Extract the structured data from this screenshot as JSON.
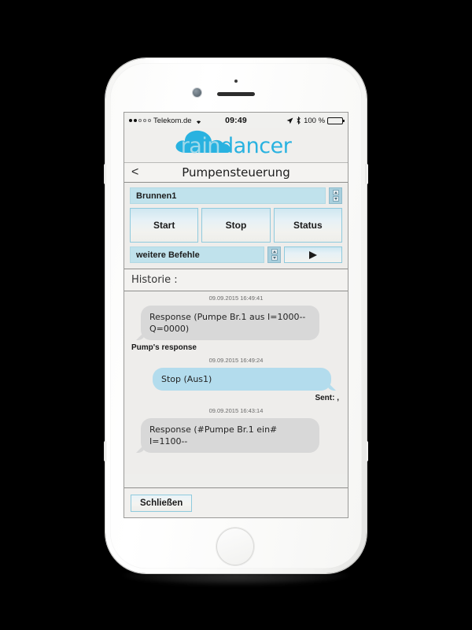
{
  "status_bar": {
    "signal_dots": [
      true,
      true,
      false,
      false,
      false
    ],
    "carrier": "Telekom.de",
    "wifi_icon": "wifi-icon",
    "time": "09:49",
    "location_icon": "location-arrow-icon",
    "bluetooth_icon": "bluetooth-icon",
    "battery_percent": "100 %",
    "battery_level": 100
  },
  "logo": {
    "part1": "rain",
    "part2": "dancer",
    "cloud_icon": "cloud-icon",
    "color_light": "#9fd9ea",
    "color_dark": "#29b2e0"
  },
  "nav": {
    "back_icon": "<",
    "title": "Pumpensteuerung"
  },
  "controls": {
    "well_select": {
      "value": "Brunnen1",
      "stepper_up_icon": "chevron-up-icon",
      "stepper_down_icon": "chevron-down-icon"
    },
    "buttons": [
      {
        "label": "Start",
        "name": "start-button"
      },
      {
        "label": "Stop",
        "name": "stop-button"
      },
      {
        "label": "Status",
        "name": "status-button"
      }
    ],
    "command_select": {
      "value": "weitere Befehle",
      "stepper_up_icon": "chevron-up-icon",
      "stepper_down_icon": "chevron-down-icon"
    },
    "send_icon": "play-triangle-icon"
  },
  "history": {
    "title": "Historie :",
    "messages": [
      {
        "timestamp": "09.09.2015 16:49:41",
        "direction": "in",
        "text": "Response (Pumpe Br.1 aus I=1000--Q=0000)",
        "meta": "Pump's response"
      },
      {
        "timestamp": "09.09.2015 16:49:24",
        "direction": "out",
        "text": "Stop (Aus1)",
        "meta": "Sent: ,"
      },
      {
        "timestamp": "09.09.2015 16:43:14",
        "direction": "in",
        "text": "Response (#Pumpe Br.1 ein# I=1100--",
        "meta": ""
      }
    ]
  },
  "footer": {
    "close_label": "Schließen"
  }
}
